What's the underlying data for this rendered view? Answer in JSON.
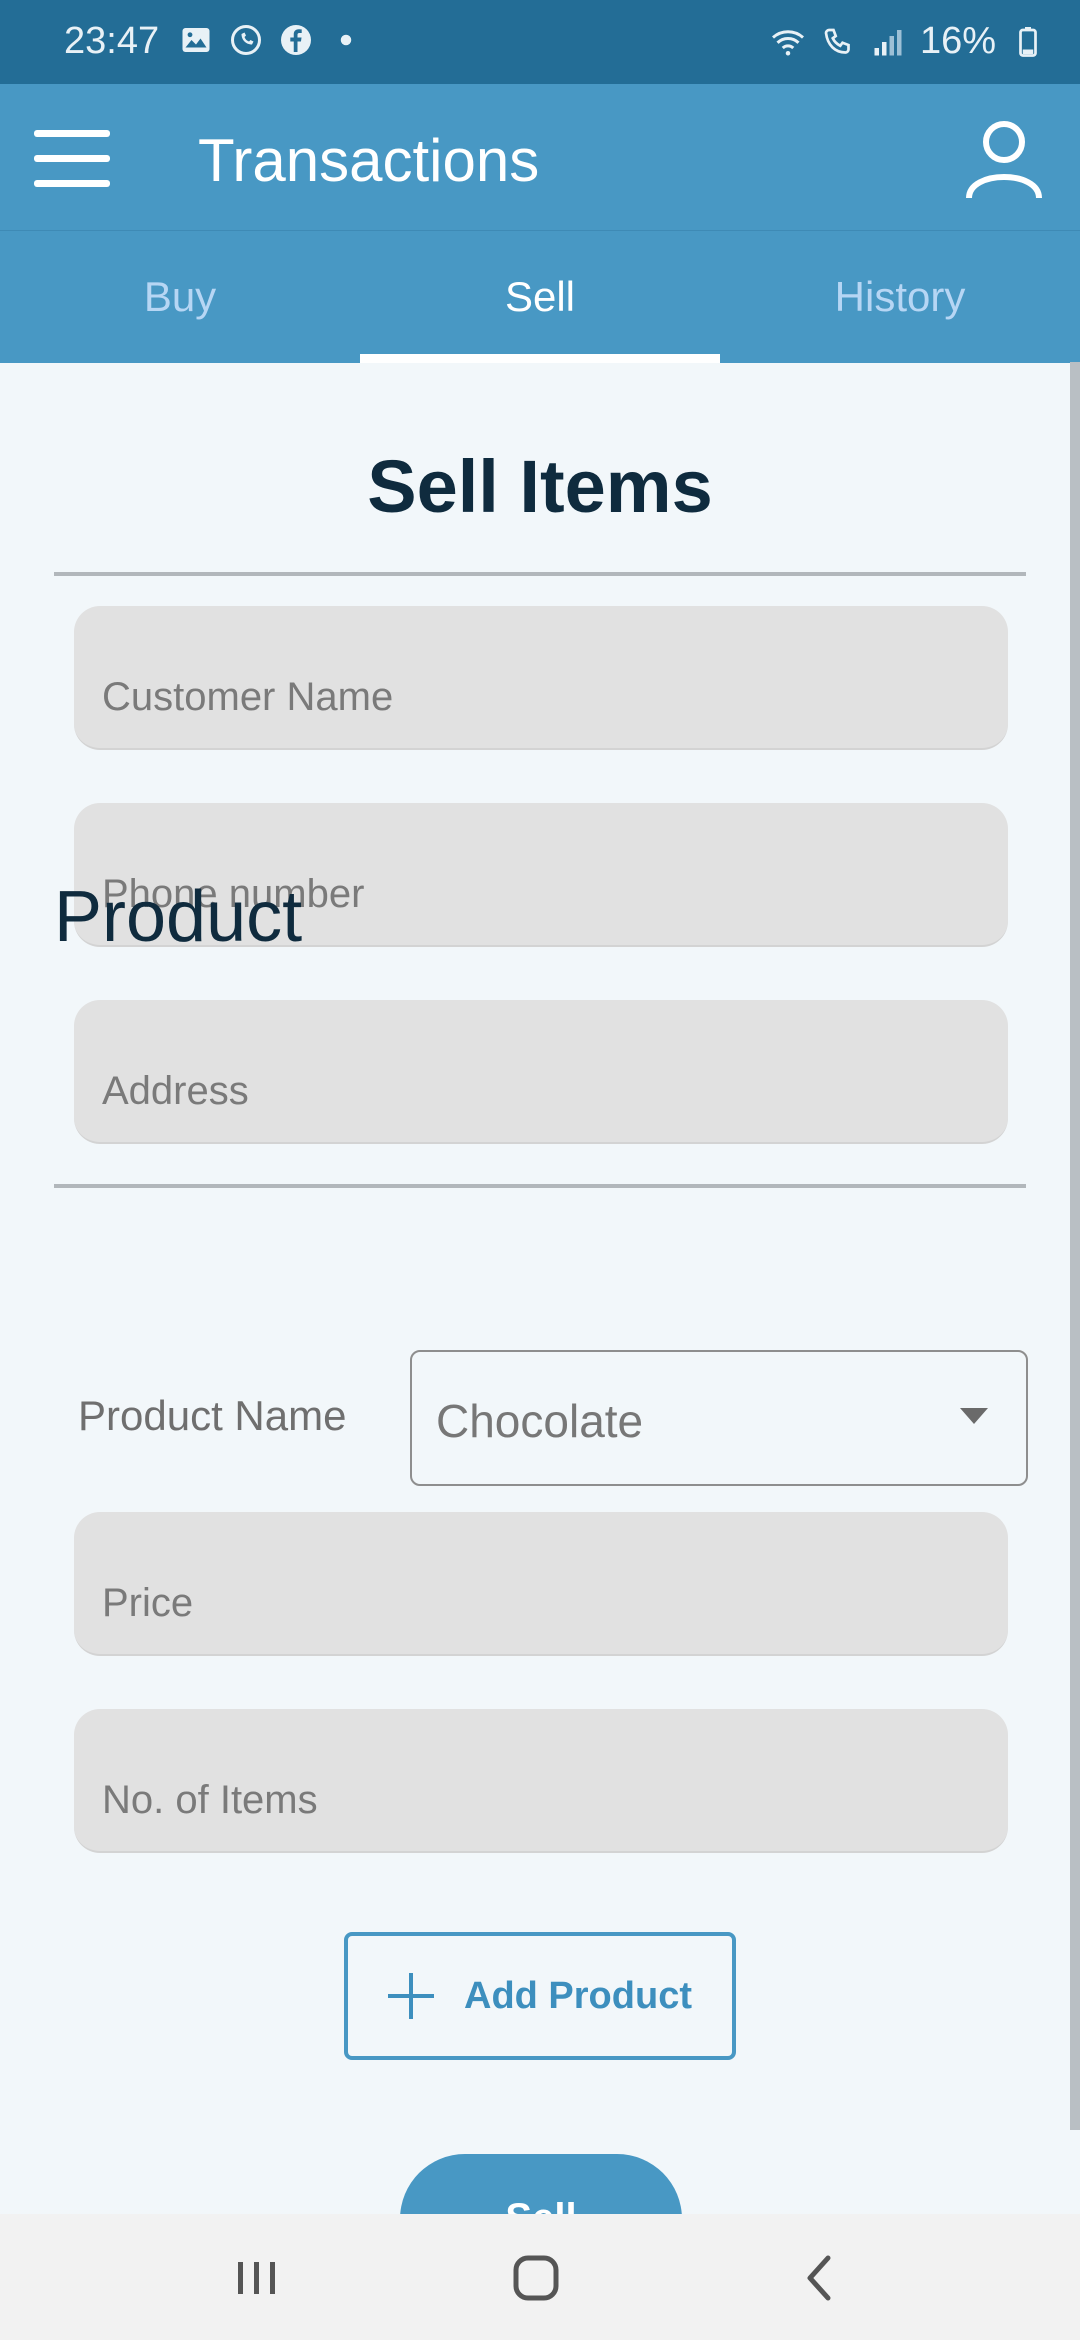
{
  "status_bar": {
    "time": "23:47",
    "battery": "16%",
    "icons_left": [
      "gallery-icon",
      "whatsapp-icon",
      "facebook-icon",
      "dot-icon"
    ],
    "icons_right": [
      "wifi-icon",
      "wifi-call-icon",
      "signal-icon",
      "battery-icon"
    ]
  },
  "app_bar": {
    "title": "Transactions",
    "menu_icon": "hamburger-menu-icon",
    "account_icon": "person-outline-icon"
  },
  "tabs": [
    {
      "label": "Buy",
      "active": false
    },
    {
      "label": "Sell",
      "active": true
    },
    {
      "label": "History",
      "active": false
    }
  ],
  "form": {
    "title": "Sell Items",
    "customer_name": {
      "placeholder": "Customer Name",
      "value": ""
    },
    "phone": {
      "placeholder": "Phone number",
      "value": ""
    },
    "address": {
      "placeholder": "Address",
      "value": ""
    }
  },
  "product": {
    "heading": "Product",
    "name_label": "Product Name",
    "selected": "Chocolate",
    "price": {
      "placeholder": "Price",
      "value": ""
    },
    "items": {
      "placeholder": "No. of Items",
      "value": ""
    },
    "add_label": "Add Product"
  },
  "actions": {
    "sell_label": "Sell"
  },
  "colors": {
    "status_bar": "#236d96",
    "app_bar": "#4898c4",
    "tab_inactive": "#b6d6f4",
    "heading": "#0f2b3e",
    "field_bg": "#e1e1e1",
    "background": "#f2f7fa"
  }
}
